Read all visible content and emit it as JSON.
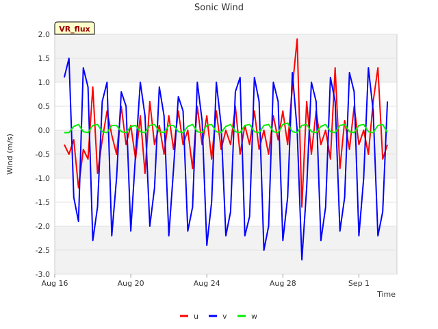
{
  "chart_data": {
    "type": "line",
    "title": "Sonic Wind",
    "xlabel": "Time",
    "ylabel": "Wind (m/s)",
    "badge": "VR_flux",
    "xlim": [
      "2023-08-16",
      "2023-09-03"
    ],
    "ylim": [
      -3.0,
      2.0
    ],
    "yticks": [
      -3.0,
      -2.5,
      -2.0,
      -1.5,
      -1.0,
      -0.5,
      0.0,
      0.5,
      1.0,
      1.5,
      2.0
    ],
    "yticklabels": [
      "-3.0",
      "-2.5",
      "-2.0",
      "-1.5",
      "-1.0",
      "-0.5",
      "0.0",
      "0.5",
      "1.0",
      "1.5",
      "2.0"
    ],
    "xticks": [
      "2023-08-16",
      "2023-08-20",
      "2023-08-24",
      "2023-08-28",
      "2023-09-01"
    ],
    "xticklabels": [
      "Aug 16",
      "Aug 20",
      "Aug 24",
      "Aug 28",
      "Sep 1"
    ],
    "grid": "horizontal bands",
    "legend_position": "bottom-center",
    "x": [
      "2023-08-16 12:00",
      "2023-08-16 18:00",
      "2023-08-17 00:00",
      "2023-08-17 06:00",
      "2023-08-17 12:00",
      "2023-08-17 18:00",
      "2023-08-18 00:00",
      "2023-08-18 06:00",
      "2023-08-18 12:00",
      "2023-08-18 18:00",
      "2023-08-19 00:00",
      "2023-08-19 06:00",
      "2023-08-19 12:00",
      "2023-08-19 18:00",
      "2023-08-20 00:00",
      "2023-08-20 06:00",
      "2023-08-20 12:00",
      "2023-08-20 18:00",
      "2023-08-21 00:00",
      "2023-08-21 06:00",
      "2023-08-21 12:00",
      "2023-08-21 18:00",
      "2023-08-22 00:00",
      "2023-08-22 06:00",
      "2023-08-22 12:00",
      "2023-08-22 18:00",
      "2023-08-23 00:00",
      "2023-08-23 06:00",
      "2023-08-23 12:00",
      "2023-08-23 18:00",
      "2023-08-24 00:00",
      "2023-08-24 06:00",
      "2023-08-24 12:00",
      "2023-08-24 18:00",
      "2023-08-25 00:00",
      "2023-08-25 06:00",
      "2023-08-25 12:00",
      "2023-08-25 18:00",
      "2023-08-26 00:00",
      "2023-08-26 06:00",
      "2023-08-26 12:00",
      "2023-08-26 18:00",
      "2023-08-27 00:00",
      "2023-08-27 06:00",
      "2023-08-27 12:00",
      "2023-08-27 18:00",
      "2023-08-28 00:00",
      "2023-08-28 06:00",
      "2023-08-28 12:00",
      "2023-08-28 18:00",
      "2023-08-29 00:00",
      "2023-08-29 06:00",
      "2023-08-29 12:00",
      "2023-08-29 18:00",
      "2023-08-30 00:00",
      "2023-08-30 06:00",
      "2023-08-30 12:00",
      "2023-08-30 18:00",
      "2023-08-31 00:00",
      "2023-08-31 06:00",
      "2023-08-31 12:00",
      "2023-08-31 18:00",
      "2023-09-01 00:00",
      "2023-09-01 06:00",
      "2023-09-01 12:00",
      "2023-09-01 18:00",
      "2023-09-02 00:00",
      "2023-09-02 06:00",
      "2023-09-02 12:00"
    ],
    "series": [
      {
        "name": "u",
        "color": "#ff0000",
        "values": [
          -0.3,
          -0.5,
          -0.2,
          -1.2,
          -0.4,
          -0.6,
          0.9,
          -0.9,
          -0.2,
          0.4,
          -0.1,
          -0.5,
          0.5,
          -0.3,
          0.1,
          -0.6,
          0.3,
          -0.9,
          0.6,
          -0.3,
          0.1,
          -0.5,
          0.3,
          -0.4,
          0.4,
          -0.3,
          0.0,
          -0.8,
          0.5,
          -0.3,
          0.3,
          -0.6,
          0.4,
          -0.4,
          0.0,
          -0.3,
          0.5,
          -0.5,
          0.1,
          -0.3,
          0.4,
          -0.4,
          0.0,
          -0.5,
          0.3,
          -0.2,
          0.4,
          -0.3,
          0.9,
          1.9,
          -1.6,
          0.6,
          -0.5,
          0.4,
          -0.3,
          0.0,
          -0.6,
          1.3,
          -0.8,
          0.2,
          -0.4,
          0.5,
          -0.3,
          0.0,
          -0.5,
          0.6,
          1.3,
          -0.6,
          -0.3
        ]
      },
      {
        "name": "v",
        "color": "#0000ff",
        "values": [
          1.1,
          1.5,
          -1.4,
          -1.9,
          1.3,
          0.9,
          -2.3,
          -1.6,
          0.6,
          1.0,
          -2.2,
          -1.0,
          0.8,
          0.5,
          -2.1,
          -0.5,
          1.0,
          0.3,
          -2.0,
          -1.2,
          0.9,
          0.3,
          -2.2,
          -0.8,
          0.7,
          0.4,
          -2.1,
          -1.6,
          1.0,
          0.2,
          -2.4,
          -1.5,
          1.0,
          0.1,
          -2.2,
          -1.7,
          0.8,
          1.1,
          -2.2,
          -1.8,
          1.1,
          0.6,
          -2.5,
          -2.0,
          1.0,
          0.6,
          -2.3,
          -1.4,
          1.2,
          0.0,
          -2.7,
          -1.2,
          1.0,
          0.6,
          -2.3,
          -1.6,
          1.1,
          0.6,
          -2.1,
          -1.4,
          1.2,
          0.8,
          -2.2,
          -1.0,
          1.3,
          0.4,
          -2.2,
          -1.7,
          0.6
        ]
      },
      {
        "name": "w",
        "color": "#00ee00",
        "values": [
          -0.05,
          -0.05,
          0.08,
          0.12,
          -0.03,
          -0.05,
          0.1,
          0.12,
          -0.03,
          -0.05,
          0.1,
          0.1,
          -0.03,
          -0.05,
          0.08,
          0.1,
          -0.03,
          -0.05,
          0.1,
          0.12,
          -0.03,
          -0.05,
          0.1,
          0.1,
          -0.03,
          -0.05,
          0.08,
          0.12,
          -0.03,
          -0.05,
          0.1,
          0.12,
          -0.03,
          -0.05,
          0.08,
          0.12,
          -0.03,
          -0.05,
          0.1,
          0.12,
          -0.03,
          -0.05,
          0.1,
          0.12,
          -0.03,
          -0.05,
          0.12,
          0.15,
          -0.03,
          -0.05,
          0.1,
          0.12,
          -0.03,
          -0.05,
          0.08,
          0.12,
          -0.03,
          -0.05,
          0.1,
          0.12,
          -0.03,
          -0.05,
          0.1,
          0.12,
          -0.03,
          -0.05,
          0.1,
          0.12,
          -0.05
        ]
      }
    ]
  }
}
